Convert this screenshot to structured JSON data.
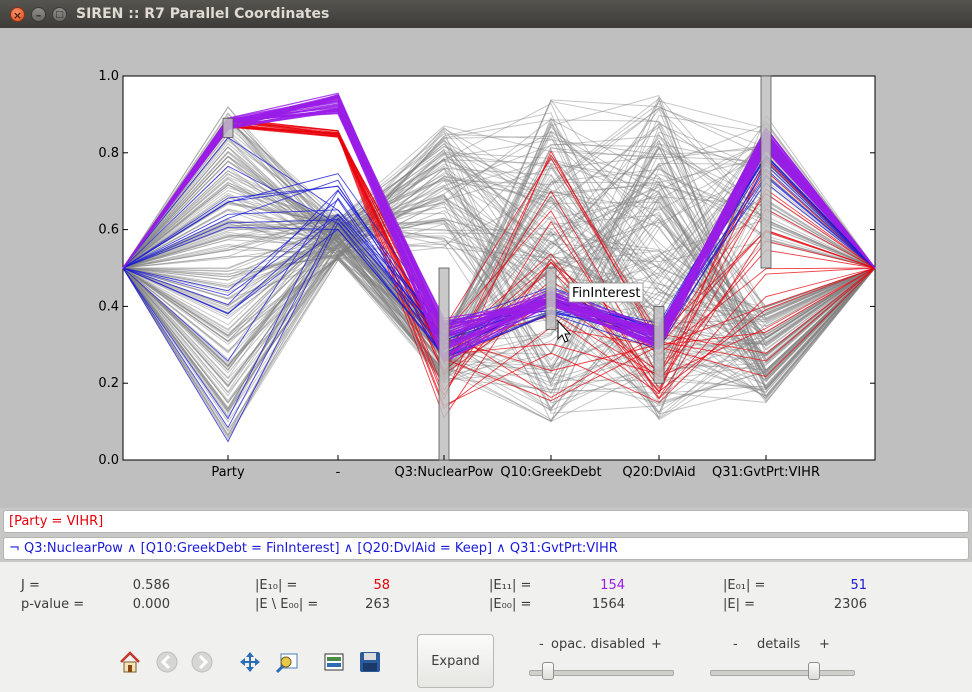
{
  "window": {
    "title": "SIREN :: R7 Parallel Coordinates",
    "close_glyph": "×",
    "min_glyph": "–",
    "max_glyph": "□"
  },
  "chart_data": {
    "type": "parallel-coordinates",
    "axes": [
      "Party",
      "-",
      "Q3:NuclearPow",
      "Q10:GreekDebt",
      "Q20:DvlAid",
      "Q31:GvtPrt:VIHR"
    ],
    "yticks": [
      "1.0",
      "0.8",
      "0.6",
      "0.4",
      "0.2",
      "0.0"
    ],
    "ylim": [
      0,
      1
    ],
    "annotation": "FinInterest",
    "highlight_intervals": [
      {
        "axis": "Party",
        "low": 0.84,
        "high": 0.89
      },
      {
        "axis": "Q3:NuclearPow",
        "low": 0.0,
        "high": 0.5
      },
      {
        "axis": "Q10:GreekDebt",
        "low": 0.34,
        "high": 0.5
      },
      {
        "axis": "Q20:DvlAid",
        "low": 0.2,
        "high": 0.4
      },
      {
        "axis": "Q31:GvtPrt:VIHR",
        "low": 0.5,
        "high": 1.0
      }
    ],
    "colors": {
      "both": "#9a1de6",
      "left_only": "#e8000b",
      "right_only": "#1a1ad8",
      "neither": "#808080",
      "background": "#ffffff",
      "frame": "#bfbfbf",
      "interval": "#c0c0c0"
    }
  },
  "rules": {
    "left": "[Party = VIHR]",
    "right": "¬ Q3:NuclearPow ∧ [Q10:GreekDebt = FinInterest] ∧ [Q20:DvlAid = Keep] ∧ Q31:GvtPrt:VIHR"
  },
  "stats": {
    "j_label": "J =",
    "j_value": "0.586",
    "p_label": "p-value =",
    "p_value": "0.000",
    "e10_label": "|E₁₀| =",
    "e10_value": "58",
    "eminus_label": "|E \\ E₀₀| =",
    "eminus_value": "263",
    "e11_label": "|E₁₁| =",
    "e11_value": "154",
    "e00_label": "|E₀₀| =",
    "e00_value": "1564",
    "e01_label": "|E₀₁| =",
    "e01_value": "51",
    "e_label": "|E| =",
    "e_value": "2306",
    "colors": {
      "e10": "#e8000b",
      "e11": "#9a1de6",
      "e01": "#1a1ad8"
    }
  },
  "toolbar": {
    "icons": [
      "home-icon",
      "back-icon",
      "forward-icon",
      "pan-icon",
      "zoom-icon",
      "configure-subplots-icon",
      "save-icon"
    ],
    "expand_label": "Expand"
  },
  "sliders": {
    "opacity": {
      "minus": "-",
      "label": "opac. disabled",
      "plus": "+",
      "value": 0.1
    },
    "details": {
      "minus": "-",
      "label": "details",
      "plus": "+",
      "value": 0.75
    }
  }
}
